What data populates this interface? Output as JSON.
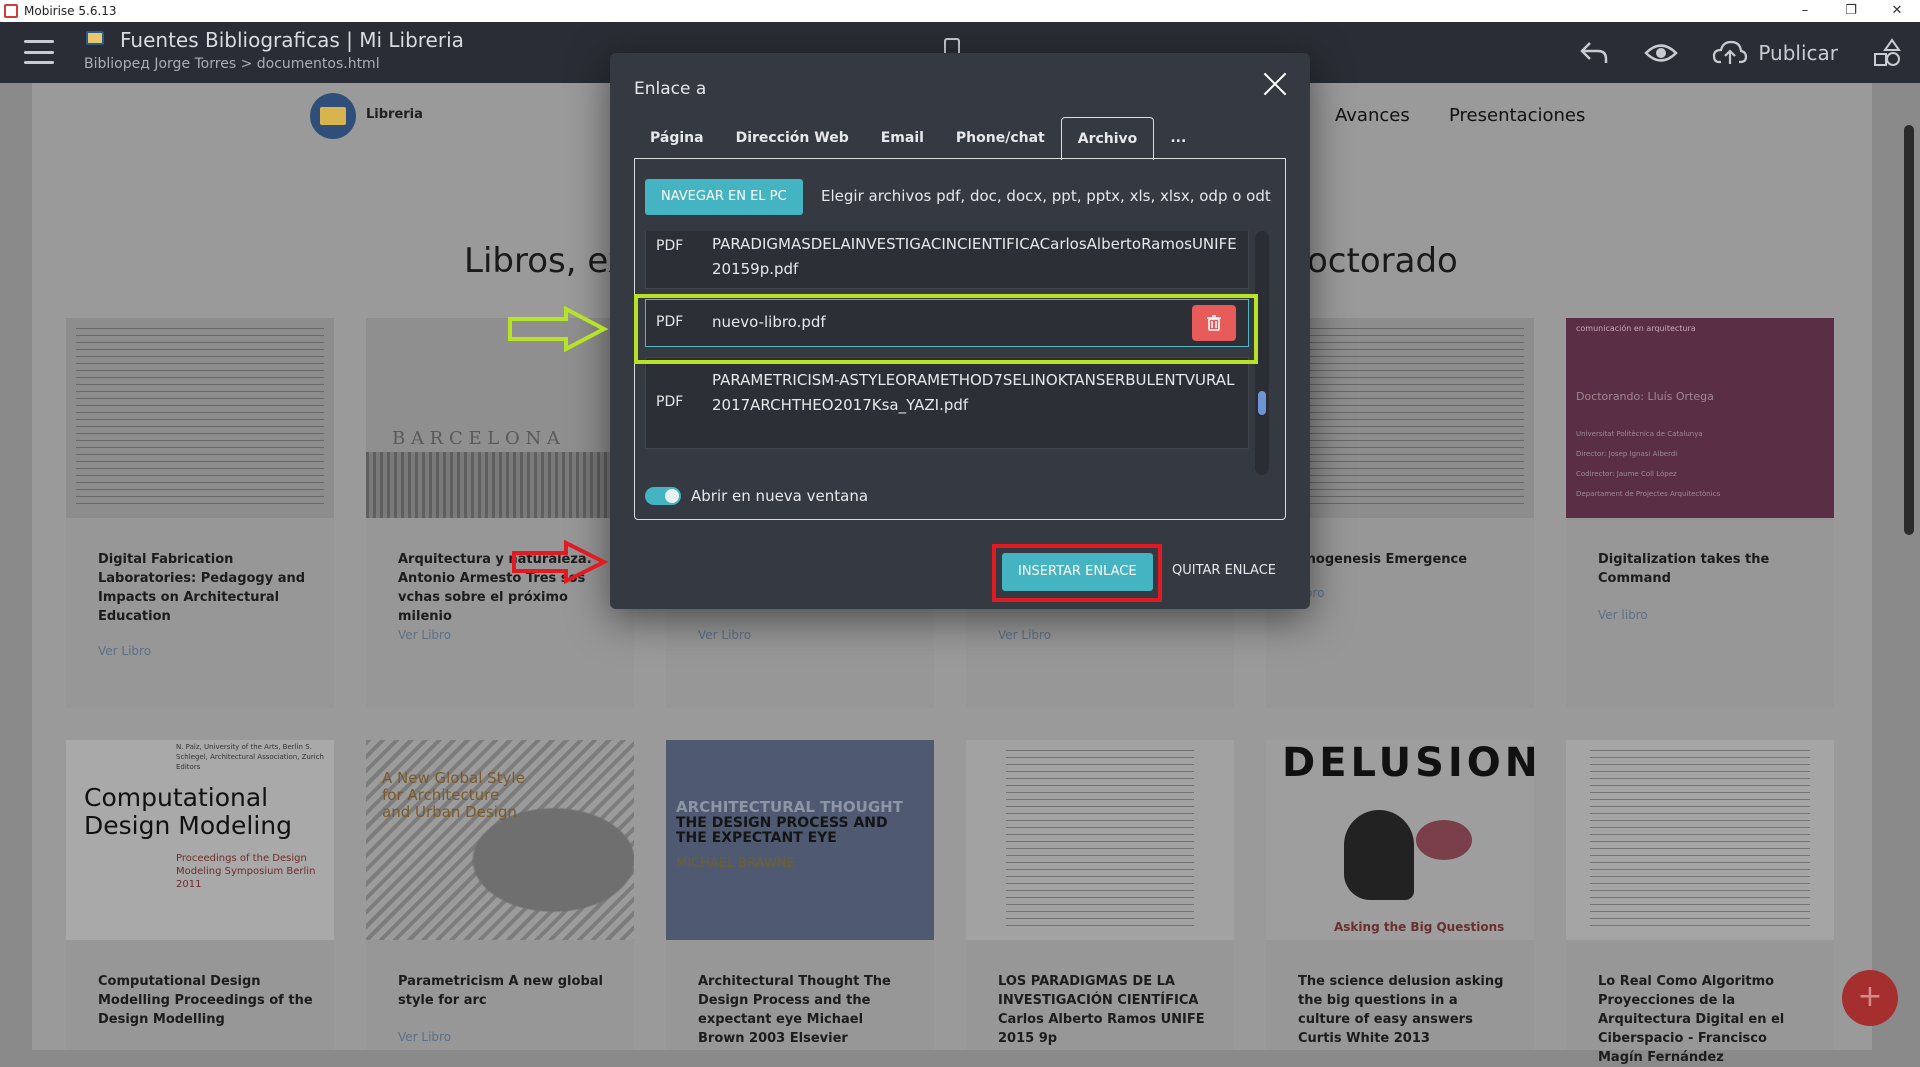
{
  "os": {
    "title": "Mobirise 5.6.13"
  },
  "header": {
    "title": "Fuentes Bibliograficas | Mi Libreria",
    "breadcrumb": "Biblioред Jorge Torres > documentos.html",
    "publish_label": "Publicar"
  },
  "page": {
    "brand": "Libreria",
    "nav": [
      "Avances",
      "Presentaciones"
    ],
    "heading_left": "Libros, ex",
    "heading_right": "octorado",
    "cards_row1": [
      {
        "title": "Digital Fabrication Laboratories: Pedagogy and Impacts on Architectural Education",
        "link": "Ver Libro"
      },
      {
        "title": "Arquitectura y naturaleza. Antonio Armesto Tres sos  vchas sobre el próximo milenio",
        "link": "Ver Libro"
      },
      {
        "title": "",
        "link": "Ver Libro"
      },
      {
        "title": "",
        "link": "Ver Libro"
      },
      {
        "title": "orphogenesis Emergence",
        "link": "er libro"
      },
      {
        "title": "Digitalization takes the Command",
        "link": "Ver libro"
      }
    ],
    "cards_row2": [
      {
        "title": "Computational Design Modelling Proceedings of the Design Modelling",
        "link": ""
      },
      {
        "title": "Parametricism A new global style for arc",
        "link": "Ver Libro"
      },
      {
        "title": "Architectural Thought The Design Process and the expectant eye Michael Brown 2003 Elsevier",
        "link": ""
      },
      {
        "title": "LOS PARADIGMAS DE LA INVESTIGACIÓN CIENTÍFICA Carlos Alberto Ramos UNIFE 2015 9p",
        "link": ""
      },
      {
        "title": "The science delusion asking the big questions in a culture of easy answers Curtis White 2013",
        "link": ""
      },
      {
        "title": "Lo Real Como Algoritmo Proyecciones de la Arquitectura Digital en el Ciberspacio - Francisco Magín Fernández",
        "link": ""
      }
    ],
    "thumb_texts": {
      "barcelona": "B A R C E L O N A",
      "comp_title": "Computational Design Modeling",
      "comp_sub": "Proceedings of the Design Modeling Symposium Berlin 2011",
      "comp_authors": "N. Palz, University of the Arts, Berlin S. Schlegel, Architectural Association, Zurich Editors",
      "param_title": "A New Global Style for Architecture and Urban Design",
      "arch_title1": "ARCHITECTURAL THOUGHT",
      "arch_title2": "THE DESIGN PROCESS AND THE EXPECTANT EYE",
      "arch_author": "MICHAEL BRAWNE",
      "delusion_title": "DELUSION",
      "delusion_sub": "Asking the Big Questions",
      "digital_label": "comunicación en arquitectura",
      "digital_author": "Doctorando: Lluís Ortega",
      "digital_uni": "Universitat Politècnica de Catalunya",
      "digital_dir": "Director: Josep Ignasi Alberdi",
      "digital_codir": "Codirector: Jaume Coll López",
      "digital_dept": "Departament de Projectes Arquitectònics"
    }
  },
  "modal": {
    "title": "Enlace a",
    "tabs": [
      "Página",
      "Dirección Web",
      "Email",
      "Phone/chat",
      "Archivo",
      "..."
    ],
    "active_tab": "Archivo",
    "browse_label": "NAVEGAR EN EL PC",
    "file_hint": "Elegir archivos pdf, doc, docx, ppt, pptx, xls, xlsx, odp o odt",
    "files": [
      {
        "type": "PDF",
        "name": "PARADIGMASDELAINVESTIGACINCIENTIFICACarlosAlbertoRamosUNIFE20159p.pdf"
      },
      {
        "type": "PDF",
        "name": "nuevo-libro.pdf"
      },
      {
        "type": "PDF",
        "name": "PARAMETRICISM-ASTYLEORAMETHOD7SELINOKTANSERBULENTVURAL2017ARCHTHEO2017Ksa_YAZI.pdf"
      }
    ],
    "toggle_label": "Abrir en nueva ventana",
    "toggle_on": true,
    "insert_label": "INSERTAR ENLACE",
    "remove_label": "QUITAR ENLACE"
  },
  "colors": {
    "accent": "#44b3c2",
    "delete": "#e85b5b",
    "highlight_green": "#b8e228",
    "highlight_red": "#e21b23"
  }
}
